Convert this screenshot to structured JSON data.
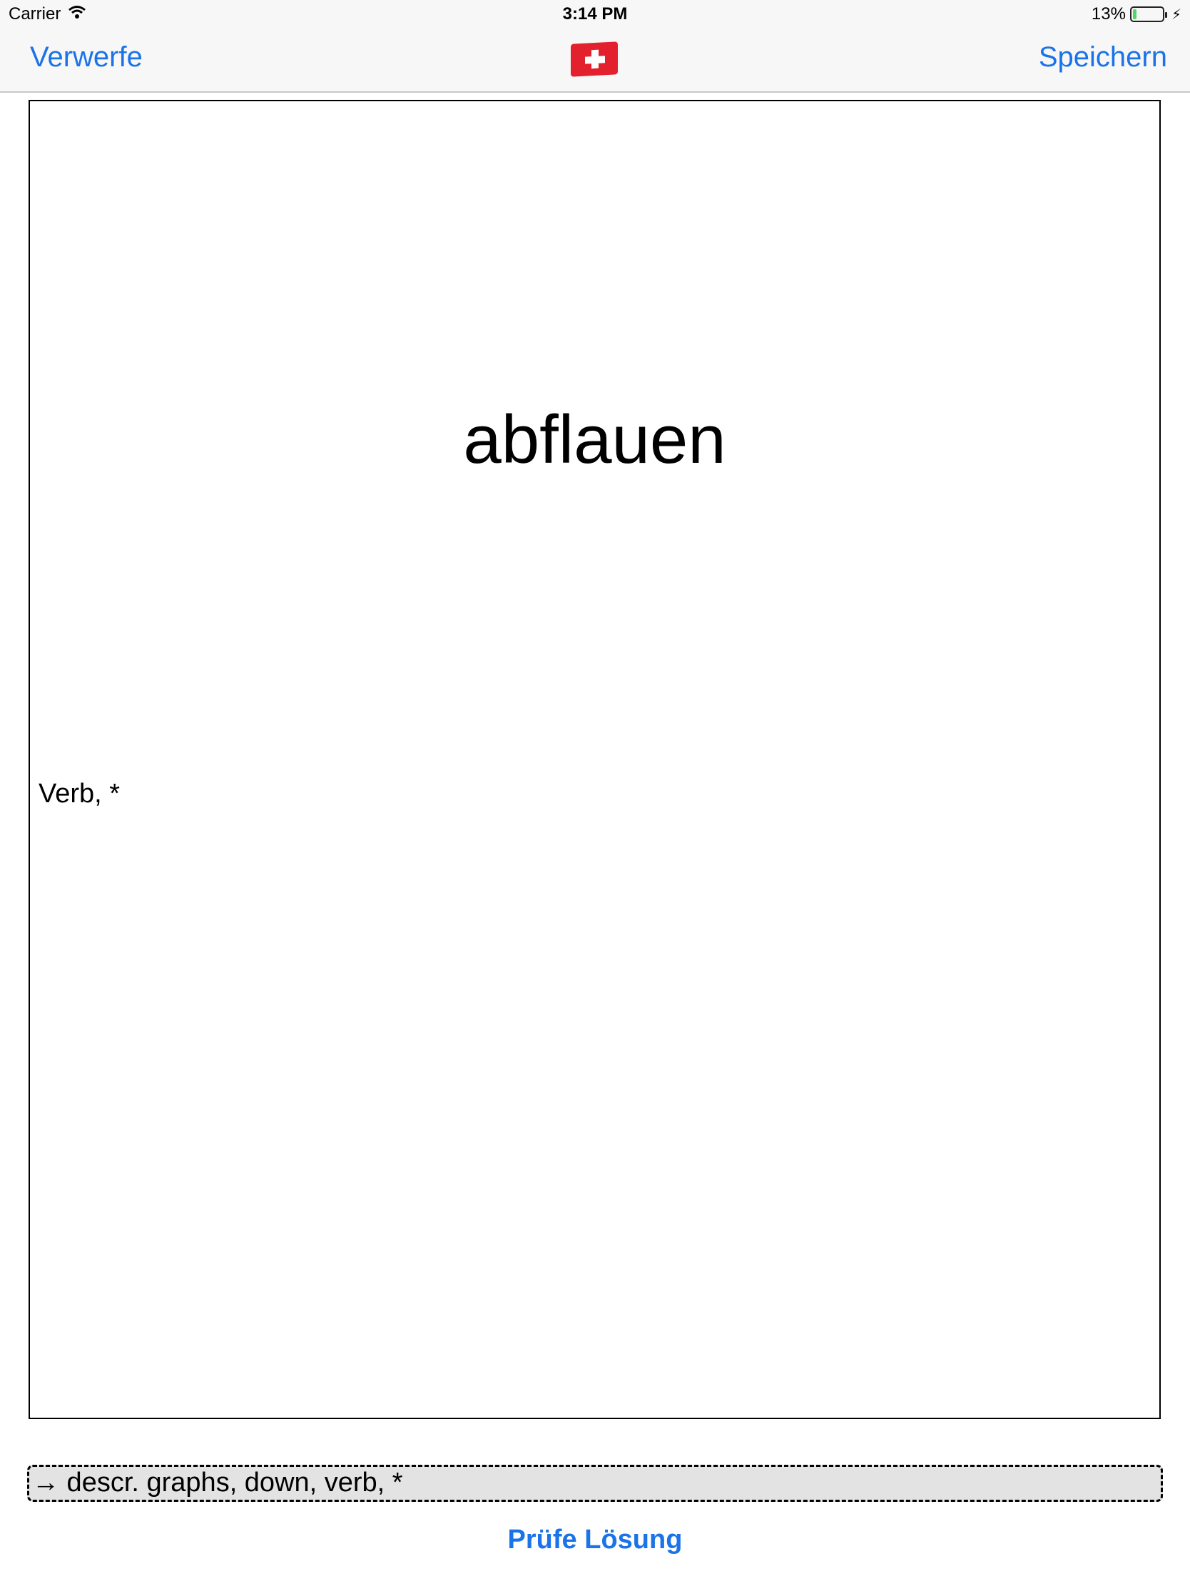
{
  "status_bar": {
    "carrier": "Carrier",
    "wifi_icon": "wifi-icon",
    "time": "3:14 PM",
    "battery_percent": "13%",
    "battery_level": 0.13,
    "charging_icon": "bolt-icon"
  },
  "nav": {
    "left_label": "Verwerfe",
    "right_label": "Speichern",
    "center_icon": "swiss-flag-icon"
  },
  "card": {
    "word": "abflauen",
    "word_type": "Verb, *"
  },
  "answer": {
    "value": "→ descr. graphs, down, verb, *"
  },
  "check_button": {
    "label": "Prüfe Lösung"
  },
  "colors": {
    "accent": "#1a73e8",
    "flag_red": "#e3212e",
    "battery_green": "#4cd964"
  }
}
